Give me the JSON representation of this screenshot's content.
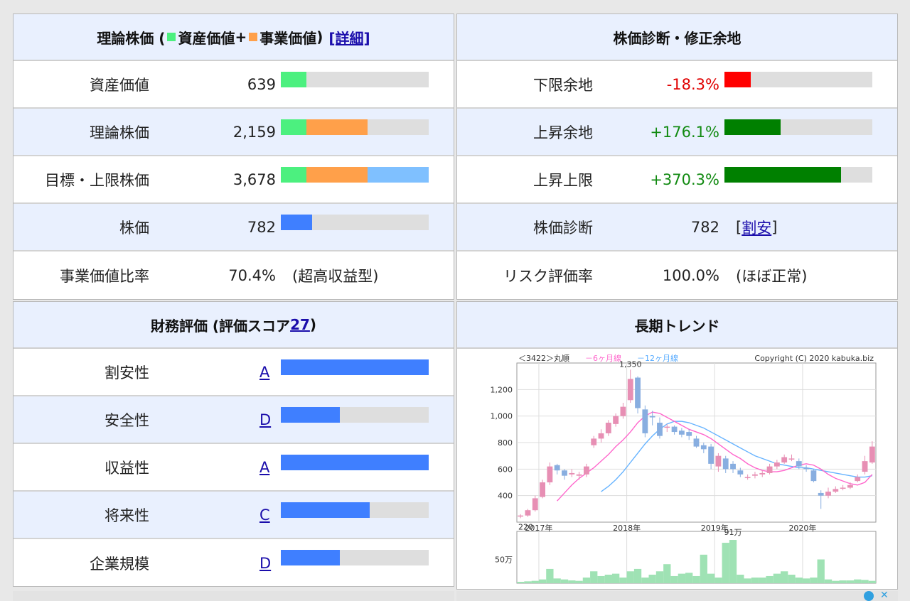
{
  "valuation": {
    "title_prefix": "理論株価 (",
    "legend_asset": "資産価値",
    "legend_plus": "+",
    "legend_business": "事業価値",
    "title_close": ")",
    "detail_link": "[詳細]",
    "rows": [
      {
        "label": "資産価値",
        "value": "639"
      },
      {
        "label": "理論株価",
        "value": "2,159"
      },
      {
        "label": "目標・上限株価",
        "value": "3,678"
      },
      {
        "label": "株価",
        "value": "782"
      },
      {
        "label": "事業価値比率",
        "value": "70.4%",
        "note": "(超高収益型)"
      }
    ],
    "bars": {
      "asset_fraction": 0.173,
      "business_fraction": 0.414,
      "upper_fraction": 0.413,
      "price_fraction": 0.212
    }
  },
  "diagnosis": {
    "title": "株価診断・修正余地",
    "rows": [
      {
        "label": "下限余地",
        "value": "-18.3%",
        "fraction": 0.18
      },
      {
        "label": "上昇余地",
        "value": "+176.1%",
        "fraction": 0.38
      },
      {
        "label": "上昇上限",
        "value": "+370.3%",
        "fraction": 0.79
      },
      {
        "label": "株価診断",
        "value": "782",
        "link": "割安",
        "bracket_open": "[",
        "bracket_close": "]"
      },
      {
        "label": "リスク評価率",
        "value": "100.0%",
        "note": "(ほぼ正常)"
      }
    ]
  },
  "financial": {
    "title_prefix": "財務評価 (評価スコア ",
    "score": "27",
    "title_close": ")",
    "rows": [
      {
        "label": "割安性",
        "grade": "A",
        "fraction": 1.0
      },
      {
        "label": "安全性",
        "grade": "D",
        "fraction": 0.4
      },
      {
        "label": "収益性",
        "grade": "A",
        "fraction": 1.0
      },
      {
        "label": "将来性",
        "grade": "C",
        "fraction": 0.6
      },
      {
        "label": "企業規模",
        "grade": "D",
        "fraction": 0.4
      }
    ]
  },
  "trend": {
    "title": "長期トレンド",
    "chart_header": "＜3422＞丸順",
    "ma6_label": "－6ヶ月線",
    "ma12_label": "－12ヶ月線",
    "copyright": "Copyright (C) 2020 kabuka.biz",
    "high_label": "1,350",
    "low_label": "220",
    "volume_peak_label": "91万",
    "volume_tick_label": "50万"
  },
  "colors": {
    "asset": "#4cf07f",
    "business": "#ffa04a",
    "upper": "#7fc0ff",
    "price": "#3f7fff",
    "negative": "#ff0000",
    "positive": "#008000",
    "bar_bg": "#dedede",
    "header_bg": "#e9f0fe",
    "ma6": "#ff66cc",
    "ma12": "#66b3ff",
    "candle_up": "#e78fb4",
    "candle_down": "#88aee0",
    "volume": "#9fe2b4"
  },
  "chart_data": {
    "type": "candlestick",
    "title": "＜3422＞丸順",
    "x": [
      "2016-10",
      "2016-11",
      "2016-12",
      "2017-01",
      "2017-02",
      "2017-03",
      "2017-04",
      "2017-05",
      "2017-06",
      "2017-07",
      "2017-08",
      "2017-09",
      "2017-10",
      "2017-11",
      "2017-12",
      "2018-01",
      "2018-02",
      "2018-03",
      "2018-04",
      "2018-05",
      "2018-06",
      "2018-07",
      "2018-08",
      "2018-09",
      "2018-10",
      "2018-11",
      "2018-12",
      "2019-01",
      "2019-02",
      "2019-03",
      "2019-04",
      "2019-05",
      "2019-06",
      "2019-07",
      "2019-08",
      "2019-09",
      "2019-10",
      "2019-11",
      "2019-12",
      "2020-01",
      "2020-02",
      "2020-03",
      "2020-04",
      "2020-05",
      "2020-06",
      "2020-07",
      "2020-08",
      "2020-09",
      "2020-10"
    ],
    "xticks": [
      "2017年",
      "2018年",
      "2019年",
      "2020年"
    ],
    "yticks": [
      400,
      600,
      800,
      1000,
      1200
    ],
    "ylim": [
      200,
      1400
    ],
    "open": [
      250,
      250,
      290,
      390,
      500,
      630,
      590,
      560,
      550,
      560,
      780,
      830,
      870,
      940,
      1000,
      1120,
      1290,
      1050,
      1000,
      950,
      920,
      920,
      890,
      880,
      830,
      780,
      770,
      620,
      680,
      640,
      590,
      540,
      550,
      560,
      570,
      620,
      650,
      680,
      660,
      610,
      590,
      420,
      400,
      430,
      460,
      460,
      510,
      580,
      650
    ],
    "close": [
      250,
      290,
      380,
      500,
      620,
      590,
      550,
      570,
      560,
      620,
      830,
      870,
      950,
      1000,
      1070,
      1280,
      1060,
      870,
      990,
      850,
      920,
      880,
      860,
      850,
      770,
      750,
      640,
      700,
      600,
      600,
      560,
      540,
      560,
      570,
      620,
      650,
      690,
      680,
      620,
      600,
      510,
      400,
      430,
      450,
      460,
      480,
      540,
      660,
      770
    ],
    "high": [
      260,
      300,
      400,
      520,
      650,
      640,
      600,
      600,
      580,
      640,
      850,
      900,
      970,
      1020,
      1100,
      1350,
      1300,
      1080,
      1040,
      990,
      940,
      930,
      910,
      900,
      850,
      800,
      790,
      720,
      700,
      660,
      610,
      560,
      580,
      590,
      640,
      670,
      710,
      710,
      680,
      630,
      600,
      440,
      460,
      470,
      480,
      500,
      560,
      700,
      810
    ],
    "low": [
      230,
      240,
      280,
      380,
      480,
      560,
      520,
      540,
      520,
      540,
      760,
      800,
      850,
      920,
      980,
      1100,
      1020,
      840,
      930,
      830,
      880,
      860,
      840,
      820,
      760,
      720,
      600,
      580,
      570,
      570,
      540,
      520,
      530,
      540,
      560,
      600,
      640,
      660,
      600,
      580,
      500,
      300,
      380,
      420,
      440,
      450,
      500,
      560,
      640
    ],
    "volume": [
      3,
      4,
      5,
      8,
      30,
      10,
      8,
      6,
      5,
      12,
      25,
      15,
      18,
      20,
      12,
      25,
      30,
      12,
      18,
      25,
      40,
      15,
      20,
      22,
      15,
      60,
      20,
      12,
      85,
      91,
      18,
      10,
      12,
      12,
      15,
      20,
      25,
      18,
      12,
      10,
      12,
      50,
      8,
      5,
      6,
      6,
      8,
      7,
      5
    ],
    "ma6": [
      null,
      null,
      null,
      null,
      null,
      360,
      420,
      480,
      530,
      570,
      610,
      660,
      710,
      770,
      820,
      880,
      950,
      1000,
      1030,
      1020,
      990,
      960,
      930,
      900,
      880,
      860,
      830,
      790,
      750,
      710,
      680,
      640,
      610,
      590,
      580,
      580,
      590,
      610,
      630,
      640,
      630,
      600,
      560,
      530,
      510,
      490,
      480,
      500,
      560
    ],
    "ma12": [
      null,
      null,
      null,
      null,
      null,
      null,
      null,
      null,
      null,
      null,
      null,
      430,
      470,
      520,
      580,
      650,
      720,
      790,
      850,
      900,
      940,
      960,
      960,
      950,
      930,
      910,
      880,
      850,
      820,
      790,
      760,
      730,
      700,
      680,
      660,
      640,
      630,
      620,
      610,
      610,
      600,
      590,
      580,
      570,
      560,
      550,
      540,
      540,
      550
    ],
    "annotations": [
      "1,350",
      "220",
      "91万",
      "50万"
    ]
  }
}
